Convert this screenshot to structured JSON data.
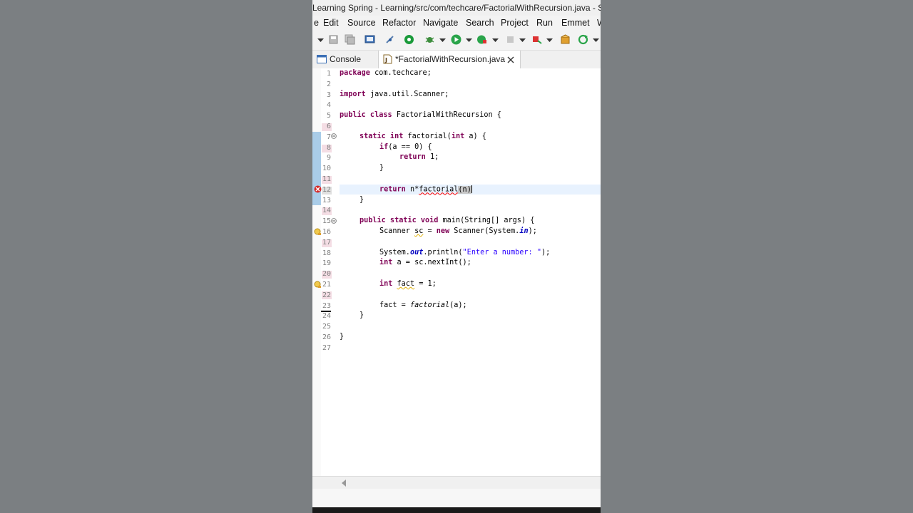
{
  "window": {
    "title": "Learning Spring - Learning/src/com/techcare/FactorialWithRecursion.java - Sp"
  },
  "menubar": {
    "items": [
      "Edit",
      "Source",
      "Refactor",
      "Navigate",
      "Search",
      "Project",
      "Run",
      "Emmet"
    ]
  },
  "tabs": {
    "console": "Console",
    "editor": "*FactorialWithRecursion.java"
  },
  "editor": {
    "line_numbers": [
      "1",
      "2",
      "3",
      "4",
      "5",
      "6",
      "7",
      "8",
      "9",
      "10",
      "11",
      "12",
      "13",
      "14",
      "15",
      "16",
      "17",
      "18",
      "19",
      "20",
      "21",
      "22",
      "23",
      "24",
      "25",
      "26",
      "27"
    ],
    "l1_kw": "package",
    "l1_rest": " com.techcare;",
    "l3_kw": "import",
    "l3_rest": " java.util.Scanner;",
    "l5_kw": "public class",
    "l5_rest": " FactorialWithRecursion {",
    "l7_kw": "static int",
    "l7_rest": " factorial(",
    "l7_kw2": "int",
    "l7_rest2": " a) {",
    "l8_kw": "if",
    "l8_rest": "(a == 0) {",
    "l9_kw": "return",
    "l9_rest": " 1;",
    "l10": "}",
    "l12_kw": "return",
    "l12_a": " n*",
    "l12_b": "factorial",
    "l12_c": "(n)",
    "l13": "}",
    "l15_kw": "public static void",
    "l15_rest": " main(String[] args) {",
    "l16_a": "Scanner ",
    "l16_var": "sc",
    "l16_b": " = ",
    "l16_kw": "new",
    "l16_c": " Scanner(System.",
    "l16_fld": "in",
    "l16_d": ");",
    "l18_a": "System.",
    "l18_fld": "out",
    "l18_b": ".println(",
    "l18_str": "\"Enter a number: \"",
    "l18_c": ");",
    "l19_kw": "int",
    "l19_rest": " a = sc.nextInt();",
    "l21_kw": "int",
    "l21_sp": " ",
    "l21_var": "fact",
    "l21_rest": " = 1;",
    "l23_a": "fact = ",
    "l23_it": "factorial",
    "l23_b": "(a);",
    "l24": "}",
    "l26": "}"
  },
  "colors": {
    "keyword": "#7f0055",
    "string": "#2a00ff",
    "field": "#0000c0",
    "error": "#ff0000",
    "current_line": "#e8f2fe"
  }
}
